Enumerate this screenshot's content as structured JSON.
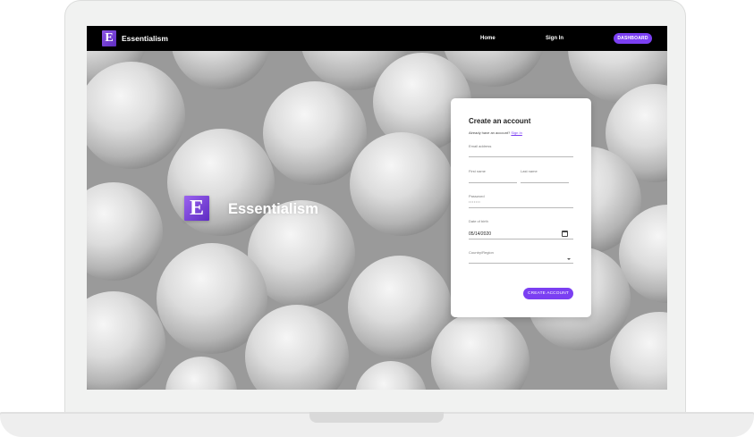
{
  "app": {
    "brand_name": "Essentialism",
    "logo_letter": "E"
  },
  "nav": {
    "links": [
      {
        "label": "Home"
      },
      {
        "label": "Sign In"
      }
    ],
    "dashboard_label": "DASHBOARD"
  },
  "hero": {
    "logo_letter": "E",
    "title": "Essentialism"
  },
  "signup_form": {
    "title": "Create an account",
    "subtitle": "Already have an account?",
    "signin_link": "Sign In",
    "fields": {
      "email": {
        "label": "Email address",
        "value": ""
      },
      "first_name": {
        "label": "First name",
        "value": ""
      },
      "last_name": {
        "label": "Last name",
        "value": ""
      },
      "password": {
        "label": "Password",
        "value": "•••••••"
      },
      "dob": {
        "label": "Date of birth",
        "value": "05/14/2020"
      },
      "country": {
        "label": "Country/Region",
        "value": ""
      }
    },
    "submit_label": "CREATE ACCOUNT"
  },
  "colors": {
    "accent": "#7b3ff2",
    "nav_bg": "#000000",
    "card_bg": "#ffffff"
  },
  "icons": [
    "calendar-icon",
    "chevron-down-icon"
  ]
}
